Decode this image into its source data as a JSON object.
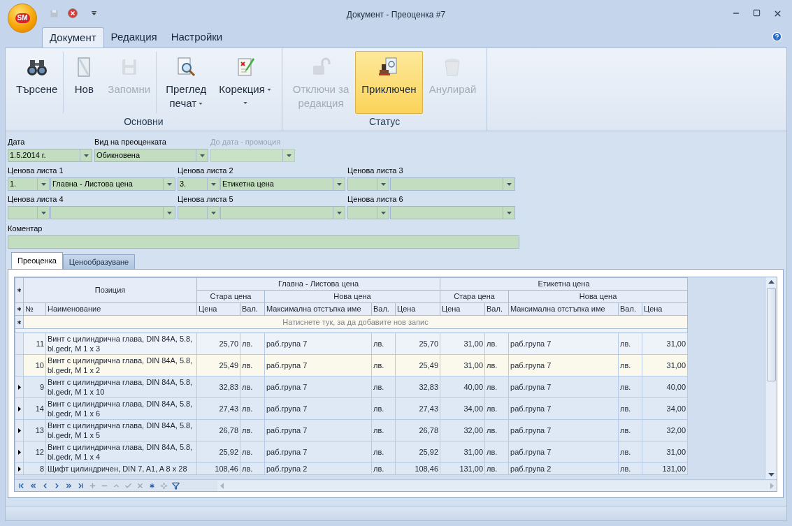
{
  "window": {
    "title": "Документ - Преоценка #7",
    "logo": "SM"
  },
  "ribbon": {
    "tabs": [
      {
        "label": "Документ",
        "selected": true
      },
      {
        "label": "Редакция",
        "selected": false
      },
      {
        "label": "Настройки",
        "selected": false
      }
    ],
    "groups": [
      {
        "label": "Основни",
        "buttons": [
          {
            "kind": "binoculars",
            "lines": [
              "Търсене"
            ],
            "disabled": false,
            "selected": false,
            "menu": false,
            "separator_after": true
          },
          {
            "kind": "page",
            "lines": [
              "Нов"
            ],
            "disabled": false,
            "selected": false,
            "menu": false,
            "separator_after": false
          },
          {
            "kind": "floppy",
            "lines": [
              "Запомни"
            ],
            "disabled": true,
            "selected": false,
            "menu": false,
            "separator_after": true
          },
          {
            "kind": "preview",
            "lines": [
              "Преглед",
              "печат"
            ],
            "disabled": false,
            "selected": false,
            "menu": true,
            "separator_after": false
          },
          {
            "kind": "edit",
            "lines": [
              "Корекция"
            ],
            "disabled": false,
            "selected": false,
            "menu": true,
            "separator_after": false
          }
        ]
      },
      {
        "label": "Статус",
        "buttons": [
          {
            "kind": "lock",
            "lines": [
              "Отключи за",
              "редакция"
            ],
            "disabled": true,
            "selected": false,
            "menu": false,
            "separator_after": false
          },
          {
            "kind": "stamp",
            "lines": [
              "Приключен"
            ],
            "disabled": false,
            "selected": true,
            "menu": false,
            "separator_after": false
          },
          {
            "kind": "trash",
            "lines": [
              "Анулирай"
            ],
            "disabled": true,
            "selected": false,
            "menu": false,
            "separator_after": false
          }
        ]
      }
    ]
  },
  "form": {
    "date": {
      "label": "Дата",
      "value": "1.5.2014 г.",
      "disabled": false
    },
    "revaluation_type": {
      "label": "Вид на преоценката",
      "value": "Обикновена",
      "disabled": false
    },
    "promo_until": {
      "label": "До дата - промоция",
      "disabled": true
    },
    "price_lists": [
      {
        "label": "Ценова листа 1",
        "number": "1.",
        "name": "Главна - Листова цена"
      },
      {
        "label": "Ценова листа 2",
        "number": "3.",
        "name": "Етикетна цена"
      },
      {
        "label": "Ценова листа 3"
      },
      {
        "label": "Ценова листа 4"
      },
      {
        "label": "Ценова листа 5"
      },
      {
        "label": "Ценова листа 6"
      }
    ],
    "comment": {
      "label": "Коментар"
    }
  },
  "tabs": [
    {
      "label": "Преоценка",
      "selected": true
    },
    {
      "label": "Ценообразуване",
      "selected": false
    }
  ],
  "grid": {
    "position_band": "Позиция",
    "bands": [
      {
        "title": "Главна - Листова цена",
        "old": "Стара цена",
        "new": "Нова цена"
      },
      {
        "title": "Етикетна цена",
        "old": "Стара цена",
        "new": "Нова цена"
      }
    ],
    "columns": [
      "№",
      "Наименование",
      "Цена",
      "Вал.",
      "Максимална отстъпка име",
      "Вал.",
      "Цена",
      "Цена",
      "Вал.",
      "Максимална отстъпка име",
      "Вал.",
      "Цена"
    ],
    "new_row_hint": "Натиснете тук, за да добавите нов запис",
    "rows": [
      {
        "expandable": false,
        "selected": false,
        "cells": [
          "11",
          "Винт с цилиндрична глава, DIN 84A, 5.8, bl.gedr, M 1 x 3",
          "25,70",
          "лв.",
          "раб.група 7",
          "лв.",
          "25,70",
          "31,00",
          "лв.",
          "раб.група 7",
          "лв.",
          "31,00"
        ]
      },
      {
        "expandable": false,
        "selected": true,
        "cells": [
          "10",
          "Винт с цилиндрична глава, DIN 84A, 5.8, bl.gedr, M 1 x 2",
          "25,49",
          "лв.",
          "раб.група 7",
          "лв.",
          "25,49",
          "31,00",
          "лв.",
          "раб.група 7",
          "лв.",
          "31,00"
        ]
      },
      {
        "expandable": true,
        "selected": false,
        "cells": [
          "9",
          "Винт с цилиндрична глава, DIN 84A, 5.8, bl.gedr, M 1 x 10",
          "32,83",
          "лв.",
          "раб.група 7",
          "лв.",
          "32,83",
          "40,00",
          "лв.",
          "раб.група 7",
          "лв.",
          "40,00"
        ]
      },
      {
        "expandable": true,
        "selected": false,
        "cells": [
          "14",
          "Винт с цилиндрична глава, DIN 84A, 5.8, bl.gedr, M 1 x 6",
          "27,43",
          "лв.",
          "раб.група 7",
          "лв.",
          "27,43",
          "34,00",
          "лв.",
          "раб.група 7",
          "лв.",
          "34,00"
        ]
      },
      {
        "expandable": true,
        "selected": false,
        "cells": [
          "13",
          "Винт с цилиндрична глава, DIN 84A, 5.8, bl.gedr, M 1 x 5",
          "26,78",
          "лв.",
          "раб.група 7",
          "лв.",
          "26,78",
          "32,00",
          "лв.",
          "раб.група 7",
          "лв.",
          "32,00"
        ]
      },
      {
        "expandable": true,
        "selected": false,
        "cells": [
          "12",
          "Винт с цилиндрична глава, DIN 84A, 5.8, bl.gedr, M 1 x 4",
          "25,92",
          "лв.",
          "раб.група 7",
          "лв.",
          "25,92",
          "31,00",
          "лв.",
          "раб.група 7",
          "лв.",
          "31,00"
        ]
      },
      {
        "expandable": true,
        "selected": false,
        "cells": [
          "8",
          "Щифт цилиндричен, DIN 7, A1, A 8 x 28",
          "108,46",
          "лв.",
          "раб.група 2",
          "лв.",
          "108,46",
          "131,00",
          "лв.",
          "раб.група 2",
          "лв.",
          "131,00"
        ]
      }
    ]
  }
}
